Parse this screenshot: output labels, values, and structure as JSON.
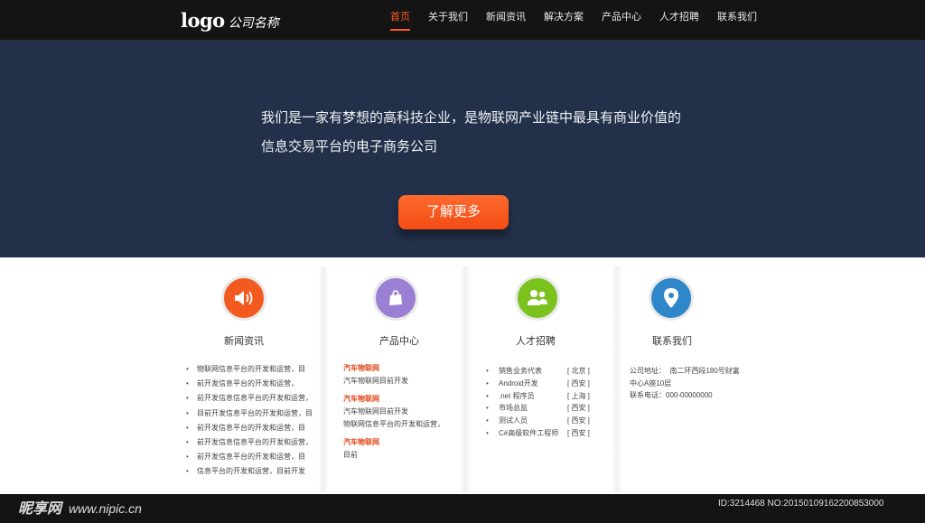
{
  "header": {
    "logo_mark": "logo",
    "logo_name": "公司名称",
    "nav": [
      {
        "label": "首页",
        "active": true
      },
      {
        "label": "关于我们"
      },
      {
        "label": "新闻资讯"
      },
      {
        "label": "解决方案"
      },
      {
        "label": "产品中心"
      },
      {
        "label": "人才招聘"
      },
      {
        "label": "联系我们"
      }
    ]
  },
  "hero": {
    "line1": "我们是一家有梦想的高科技企业，是物联网产业链中最具有商业价值的",
    "line2": "信息交易平台的电子商务公司",
    "cta_label": "了解更多"
  },
  "columns": {
    "news": {
      "title": "新闻资讯",
      "icon": "speaker-icon",
      "color": "#f25a1f",
      "items": [
        "物联网信息平台的开发和运营，目",
        "前开发信息平台的开发和运营，",
        "前开发信息信息平台的开发和运营，",
        "目前开发信息平台的开发和运营，目",
        "前开发信息平台的开发和运营，目",
        "前开发信息信息平台的开发和运营，",
        "前开发信息平台的开发和运营，目",
        "信息平台的开发和运营，目前开发"
      ]
    },
    "products": {
      "title": "产品中心",
      "icon": "shopping-bag-icon",
      "color": "#9b7fd4",
      "groups": [
        {
          "head": "汽车物联网",
          "lines": [
            "汽车物联网目前开发"
          ]
        },
        {
          "head": "汽车物联网",
          "lines": [
            "汽车物联网目前开发",
            "物联网信息平台的开发和运营，"
          ]
        },
        {
          "head": "汽车物联网",
          "lines": [
            "目前"
          ]
        }
      ]
    },
    "jobs": {
      "title": "人才招聘",
      "icon": "people-icon",
      "color": "#7cc21f",
      "items": [
        {
          "name": "销售业务代表",
          "city": "[ 北京 ]"
        },
        {
          "name": "Android开发",
          "city": "[ 西安 ]"
        },
        {
          "name": ".net 程序员",
          "city": "[ 上海 ]"
        },
        {
          "name": "市场总监",
          "city": "[ 西安 ]"
        },
        {
          "name": "测试人员",
          "city": "[ 西安 ]"
        },
        {
          "name": "C#高级软件工程师",
          "city": "[ 西安 ]"
        }
      ]
    },
    "contact": {
      "title": "联系我们",
      "icon": "location-pin-icon",
      "color": "#2f86c8",
      "address_label": "公司地址：",
      "address_line1": "南二环西段180号财富",
      "address_line2": "中心A座10层",
      "phone": "联系电话：000-00000000"
    }
  },
  "watermark": {
    "left": "昵享网",
    "url": "www.nipic.cn",
    "right": "ID:3214468 NO:20150109162200853000"
  }
}
